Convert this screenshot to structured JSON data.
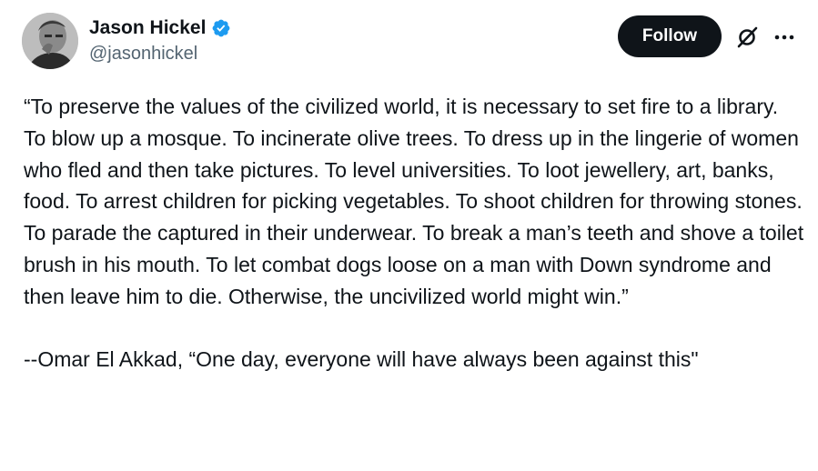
{
  "author": {
    "display_name": "Jason Hickel",
    "handle": "@jasonhickel",
    "verified": true,
    "verified_color": "#1d9bf0"
  },
  "actions": {
    "follow_label": "Follow",
    "grok_icon": "grok-slash-icon",
    "more_icon": "more-horizontal-icon"
  },
  "tweet": {
    "quote": "“To preserve the values of the civilized world, it is necessary to set fire to a library. To blow up a mosque. To incinerate olive trees. To dress up in the lingerie of women who fled and then take pictures. To level universities. To loot jewellery, art, banks, food. To arrest children for picking vegetables. To shoot children for throwing stones. To parade the captured in their underwear. To break a man’s teeth and shove a toilet brush in his mouth. To let combat dogs loose on a man with Down syndrome and then leave him to die. Otherwise, the uncivilized world might win.”",
    "attribution": "--Omar El Akkad, “One day, everyone will have always been against this\""
  },
  "colors": {
    "text": "#0f1419",
    "secondary": "#536471",
    "button_bg": "#0f1419",
    "button_text": "#ffffff"
  }
}
